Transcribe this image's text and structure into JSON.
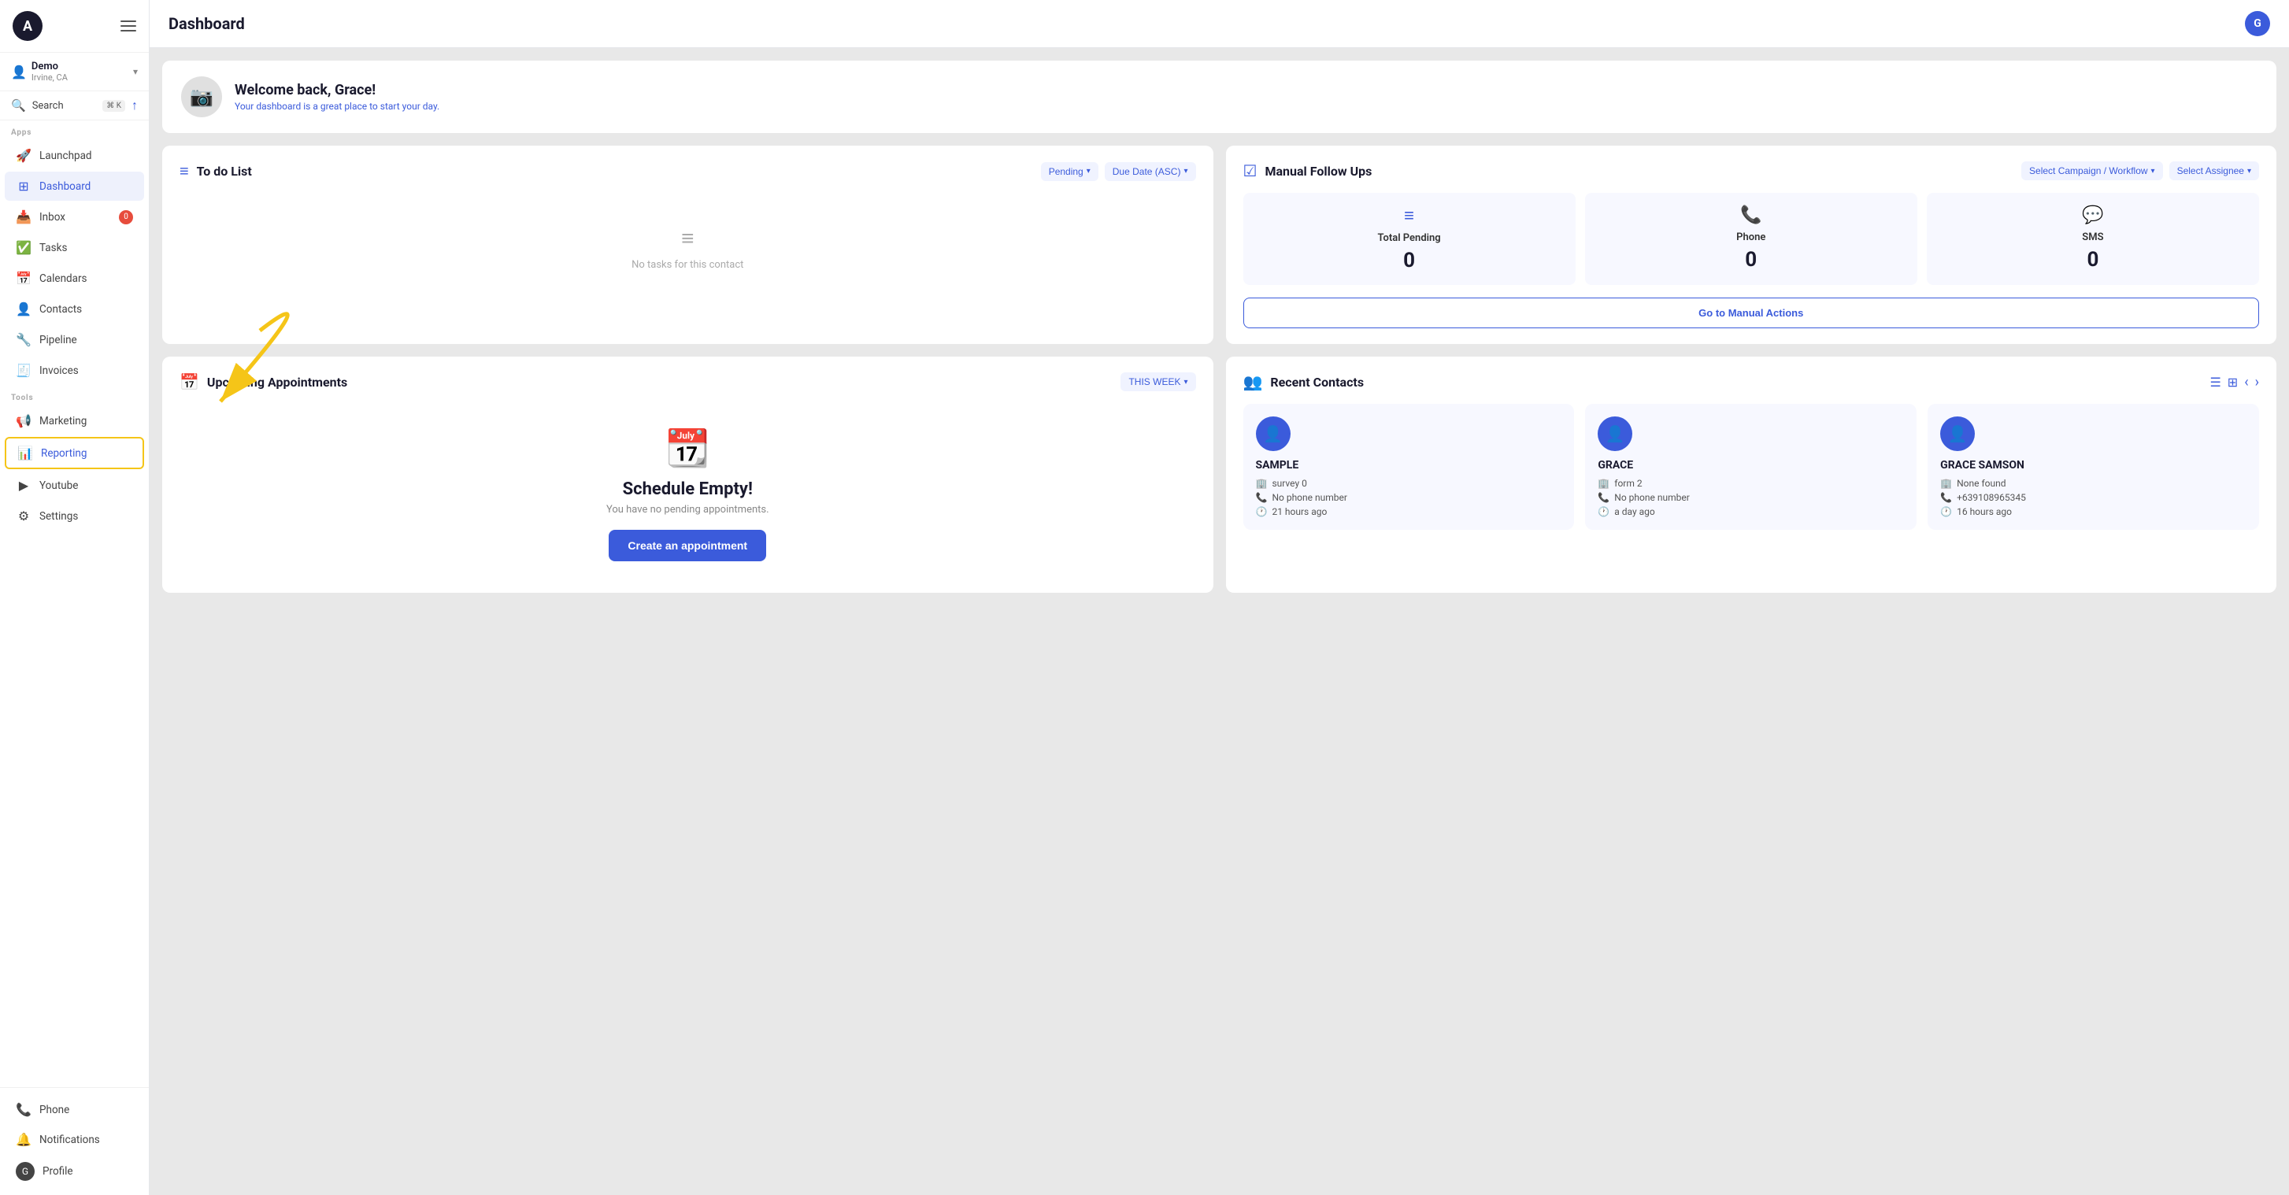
{
  "sidebar": {
    "logo_letter": "A",
    "user": {
      "name": "Demo",
      "location": "Irvine, CA"
    },
    "search": {
      "label": "Search",
      "shortcut": "⌘ K"
    },
    "apps_section": "Apps",
    "tools_section": "Tools",
    "nav_items": [
      {
        "id": "launchpad",
        "label": "Launchpad",
        "icon": "🚀",
        "badge": null,
        "active": false
      },
      {
        "id": "dashboard",
        "label": "Dashboard",
        "icon": "⊞",
        "badge": null,
        "active": true
      },
      {
        "id": "inbox",
        "label": "Inbox",
        "icon": "📥",
        "badge": "0",
        "active": false
      },
      {
        "id": "tasks",
        "label": "Tasks",
        "icon": "✅",
        "badge": null,
        "active": false
      },
      {
        "id": "calendars",
        "label": "Calendars",
        "icon": "📅",
        "badge": null,
        "active": false
      },
      {
        "id": "contacts",
        "label": "Contacts",
        "icon": "👤",
        "badge": null,
        "active": false
      },
      {
        "id": "pipeline",
        "label": "Pipeline",
        "icon": "🔧",
        "badge": null,
        "active": false
      },
      {
        "id": "invoices",
        "label": "Invoices",
        "icon": "🧾",
        "badge": null,
        "active": false
      }
    ],
    "tool_items": [
      {
        "id": "marketing",
        "label": "Marketing",
        "icon": "📢",
        "badge": null,
        "active": false
      },
      {
        "id": "reporting",
        "label": "Reporting",
        "icon": "📊",
        "badge": null,
        "active": false,
        "highlighted": true
      },
      {
        "id": "youtube",
        "label": "Youtube",
        "icon": "▶",
        "badge": null,
        "active": false
      },
      {
        "id": "settings",
        "label": "Settings",
        "icon": "⚙",
        "badge": null,
        "active": false
      }
    ],
    "bottom_items": [
      {
        "id": "phone",
        "label": "Phone",
        "icon": "📞"
      },
      {
        "id": "notifications",
        "label": "Notifications",
        "icon": "🔔"
      },
      {
        "id": "profile",
        "label": "Profile",
        "icon": "👤"
      }
    ]
  },
  "topbar": {
    "title": "Dashboard",
    "avatar_letter": "G"
  },
  "welcome": {
    "greeting": "Welcome back, Grace!",
    "subtitle": "Your dashboard is a great place to start your day."
  },
  "todo": {
    "title": "To do List",
    "filter_pending": "Pending",
    "filter_due_date": "Due Date (ASC)",
    "empty_message": "No tasks for this contact"
  },
  "manual_followups": {
    "title": "Manual Follow Ups",
    "filter_campaign": "Select Campaign / Workflow",
    "filter_assignee": "Select Assignee",
    "stats": [
      {
        "id": "total-pending",
        "icon": "≡",
        "label": "Total Pending",
        "value": "0"
      },
      {
        "id": "phone",
        "icon": "📞",
        "label": "Phone",
        "value": "0"
      },
      {
        "id": "sms",
        "icon": "💬",
        "label": "SMS",
        "value": "0"
      }
    ],
    "go_to_manual_label": "Go to Manual Actions"
  },
  "appointments": {
    "title": "Upcoming Appointments",
    "filter": "THIS WEEK",
    "empty_title": "Schedule Empty!",
    "empty_subtitle": "You have no pending appointments.",
    "create_btn": "Create an appointment"
  },
  "recent_contacts": {
    "title": "Recent Contacts",
    "contacts": [
      {
        "name": "SAMPLE",
        "source": "survey 0",
        "phone": "No phone number",
        "time": "21 hours ago"
      },
      {
        "name": "GRACE",
        "source": "form 2",
        "phone": "No phone number",
        "time": "a day ago"
      },
      {
        "name": "GRACE SAMSON",
        "source": "None found",
        "phone": "+639108965345",
        "time": "16 hours ago"
      }
    ]
  }
}
